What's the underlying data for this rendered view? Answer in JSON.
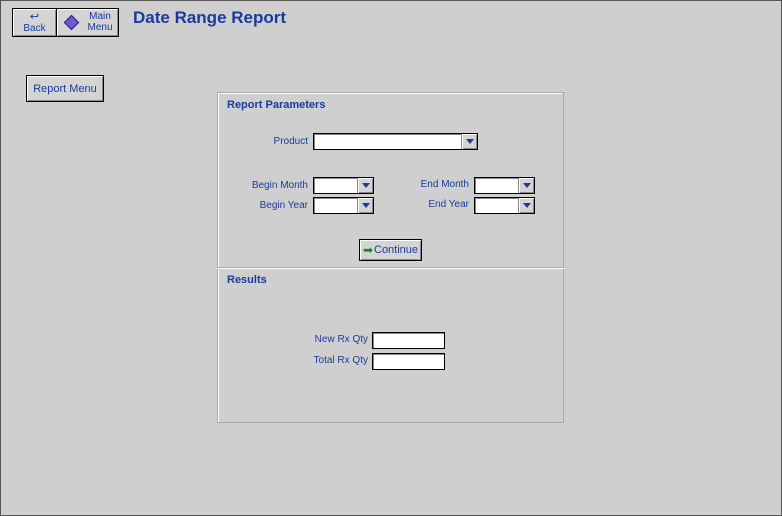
{
  "header": {
    "title": "Date Range Report",
    "back_label": "Back",
    "main_menu_label_1": "Main",
    "main_menu_label_2": "Menu"
  },
  "sidebar": {
    "report_menu_label": "Report Menu"
  },
  "parameters": {
    "section_title": "Report Parameters",
    "product_label": "Product",
    "product_value": "",
    "begin_month_label": "Begin Month",
    "begin_month_value": "",
    "begin_year_label": "Begin Year",
    "begin_year_value": "",
    "end_month_label": "End Month",
    "end_month_value": "",
    "end_year_label": "End Year",
    "end_year_value": "",
    "continue_label": "Continue"
  },
  "results": {
    "section_title": "Results",
    "new_rx_label": "New Rx Qty",
    "new_rx_value": "",
    "total_rx_label": "Total Rx Qty",
    "total_rx_value": ""
  },
  "icons": {
    "back": "undo-arrow-icon",
    "main_menu": "diamond-icon",
    "continue": "right-arrow-icon",
    "dropdown": "chevron-down-icon"
  }
}
